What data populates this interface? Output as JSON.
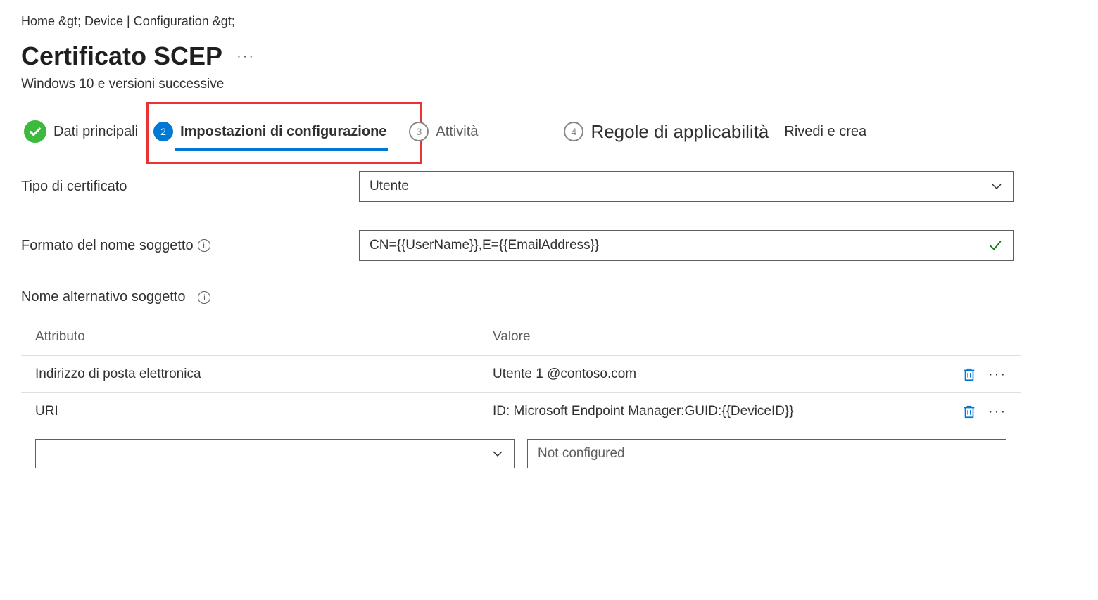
{
  "breadcrumb": "Home &gt;  Device | Configuration &gt;",
  "page_title": "Certificato SCEP",
  "subtitle": "Windows 10 e versioni successive",
  "wizard": {
    "step1": "Dati principali",
    "step2": "Impostazioni di configurazione",
    "step3_num": "3",
    "step3": "Attività",
    "step4_num": "4",
    "step4": "Regole di applicabilità",
    "step5": "Rivedi e crea"
  },
  "form": {
    "cert_type_label": "Tipo di certificato",
    "cert_type_value": "Utente",
    "subject_format_label": "Formato del nome soggetto",
    "subject_format_value": "CN={{UserName}},E={{EmailAddress}}",
    "san_label": "Nome alternativo soggetto"
  },
  "table": {
    "header_attr": "Attributo",
    "header_val": "Valore",
    "rows": [
      {
        "attr": "Indirizzo di posta elettronica",
        "val": "Utente 1 @contoso.com"
      },
      {
        "attr": "URI",
        "val": "ID: Microsoft Endpoint Manager:GUID:{{DeviceID}}"
      }
    ],
    "new_placeholder": "Not configured"
  }
}
